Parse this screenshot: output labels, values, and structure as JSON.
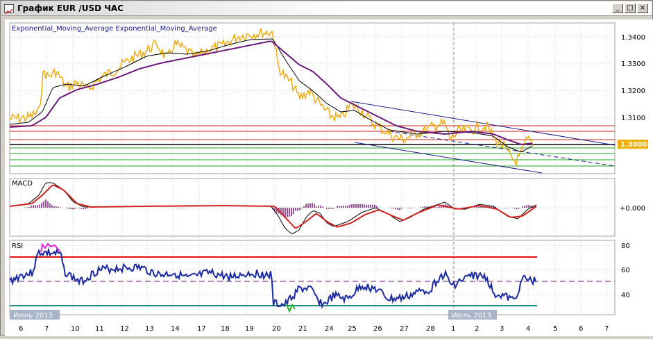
{
  "window": {
    "title": "График EUR /USD ЧАС",
    "min_symbol": "_",
    "max_symbol": "□",
    "close_symbol": "×"
  },
  "main_panel": {
    "legend": "Exponential_Moving_Average Exponential_Moving_Average",
    "price_ticks": [
      "1.3400",
      "1.3300",
      "1.3200",
      "1.3100",
      "1.3000"
    ],
    "current_price": "1.3000",
    "colors": {
      "price": "#f0a800",
      "ema_fast": "#000000",
      "ema_slow": "#6a1a7a",
      "resistance": "#d02020",
      "support": "#20a020",
      "trend": "#1a1a8a"
    }
  },
  "macd_panel": {
    "label": "MACD",
    "zero_tick": "+0.000",
    "colors": {
      "macd": "#000000",
      "signal": "#d02020",
      "histogram": "#7a1a7a"
    }
  },
  "rsi_panel": {
    "label": "RSI",
    "ticks": [
      "80",
      "60",
      "40"
    ],
    "colors": {
      "rsi": "#1a2aa0",
      "overbought_line": "#e01010",
      "oversold_line": "#1a8a8a",
      "overbought_segment": "#e020e0"
    }
  },
  "x_axis": {
    "month_labels": [
      "Июнь 2013",
      "Июль 2013"
    ],
    "day_labels": [
      "6",
      "7",
      "10",
      "11",
      "12",
      "13",
      "14",
      "17",
      "18",
      "19",
      "20",
      "21",
      "24",
      "25",
      "26",
      "27",
      "28",
      "1",
      "2",
      "3",
      "4",
      "5",
      "6",
      "7"
    ]
  }
}
